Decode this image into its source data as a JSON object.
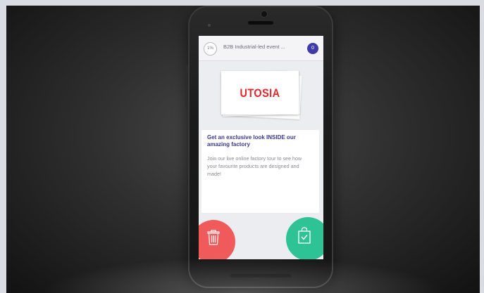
{
  "header": {
    "timer": "1%",
    "title": "B2B Industrial-led event ...",
    "counter": "0"
  },
  "card": {
    "brand": "UTOSIA",
    "headline": "Get an exclusive look INSIDE our amazing factory",
    "description": "Join our live online factory tour to see how your favourite products are designed and made!"
  },
  "actions": {
    "discard_icon": "trash-icon",
    "accept_icon": "shopping-bag-check-icon",
    "discard_color": "#f05a5a",
    "accept_color": "#2ec394"
  },
  "colors": {
    "accent": "#3e3ba8",
    "brand_red": "#e6262b"
  }
}
